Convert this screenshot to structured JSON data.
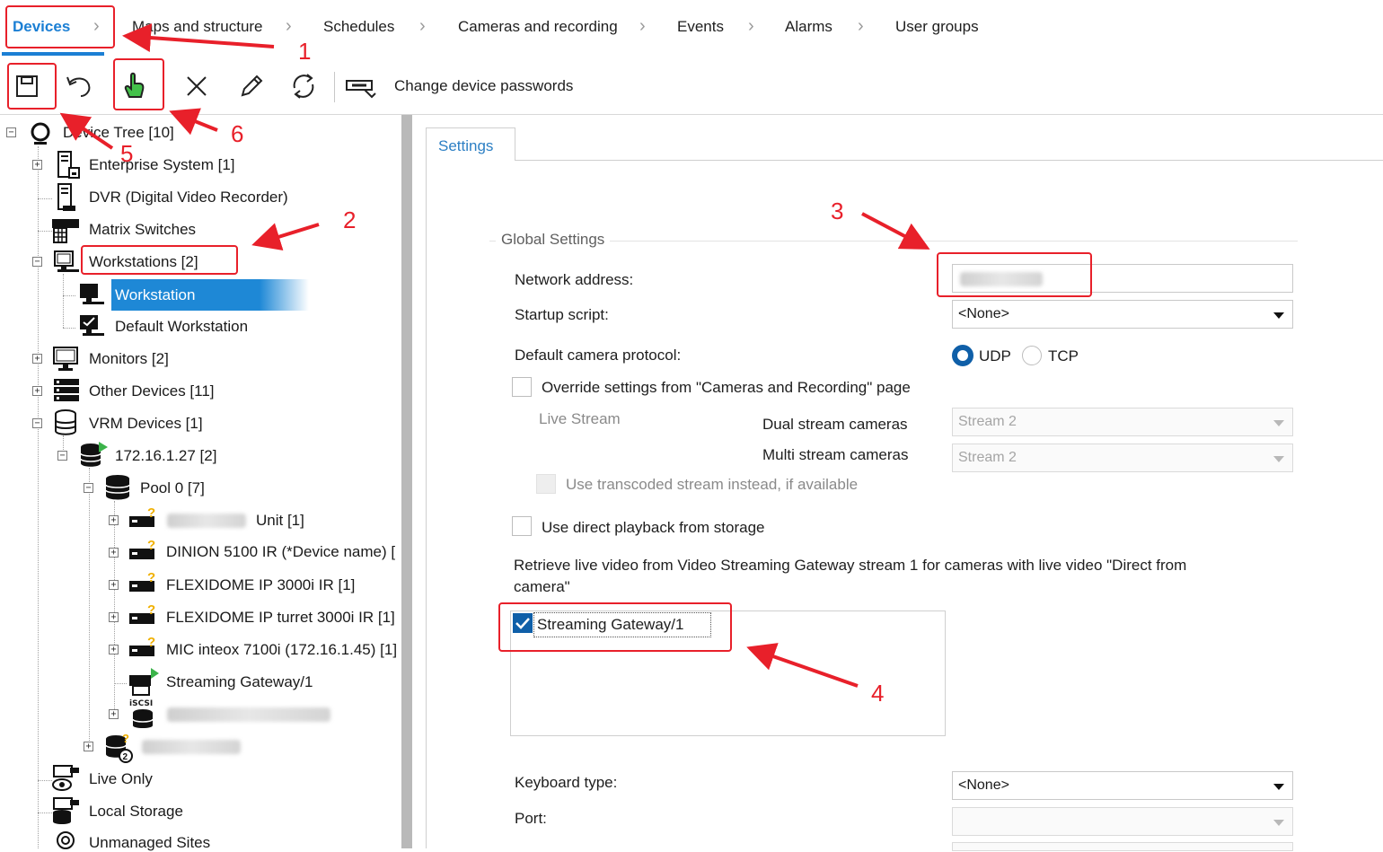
{
  "topnav": {
    "tabs": [
      {
        "label": "Devices",
        "active": true
      },
      {
        "label": "Maps and structure"
      },
      {
        "label": "Schedules"
      },
      {
        "label": "Cameras and recording"
      },
      {
        "label": "Events"
      },
      {
        "label": "Alarms"
      },
      {
        "label": "User groups"
      }
    ],
    "active_color": "#1b7fd4"
  },
  "toolbar": {
    "buttons": [
      "save-icon",
      "undo-icon",
      "hand-pointer-icon",
      "delete-icon",
      "edit-icon",
      "refresh-icon",
      "key-icon"
    ],
    "change_passwords_label": "Change device passwords"
  },
  "tree": {
    "root": "Device Tree [10]",
    "enterprise": "Enterprise System [1]",
    "dvr": "DVR (Digital Video Recorder)",
    "matrix": "Matrix Switches",
    "workstations": "Workstations [2]",
    "workstation": "Workstation",
    "default_workstation": "Default Workstation",
    "monitors": "Monitors [2]",
    "other_devices": "Other Devices [11]",
    "vrm_devices": "VRM Devices [1]",
    "vrm_ip": "172.16.1.27 [2]",
    "pool": "Pool 0 [7]",
    "unit": "Unit [1]",
    "dinion": "DINION 5100 IR (*Device name) [",
    "flexidome1": "FLEXIDOME IP 3000i IR [1]",
    "flexidome2": "FLEXIDOME IP turret 3000i IR [1]",
    "mic": "MIC inteox 7100i (172.16.1.45) [1]",
    "streaming_gateway": "Streaming Gateway/1",
    "iscsi_tag": "iSCSI",
    "live_only": "Live Only",
    "local_storage": "Local Storage",
    "unmanaged": "Unmanaged Sites",
    "selected_color": "#1e88d6"
  },
  "settings": {
    "tab_label": "Settings",
    "group_title": "Global Settings",
    "network_address_label": "Network address:",
    "startup_script_label": "Startup script:",
    "startup_script_value": "<None>",
    "camera_protocol_label": "Default camera protocol:",
    "udp_label": "UDP",
    "tcp_label": "TCP",
    "override_label": "Override settings from \"Cameras and Recording\" page",
    "live_stream_label": "Live Stream",
    "dual_stream_label": "Dual stream cameras",
    "dual_stream_value": "Stream 2",
    "multi_stream_label": "Multi stream cameras",
    "multi_stream_value": "Stream 2",
    "transcoded_label": "Use transcoded stream instead, if available",
    "direct_playback_label": "Use direct playback from storage",
    "retrieve_line1": "Retrieve live video from Video Streaming Gateway stream 1 for cameras with live video \"Direct from",
    "retrieve_line2": "camera\"",
    "gateway_item": "Streaming Gateway/1",
    "keyboard_type_label": "Keyboard type:",
    "keyboard_type_value": "<None>",
    "port_label": "Port:"
  },
  "annotations": {
    "numbers": [
      "1",
      "2",
      "3",
      "4",
      "5",
      "6"
    ],
    "color": "#e8202a"
  }
}
